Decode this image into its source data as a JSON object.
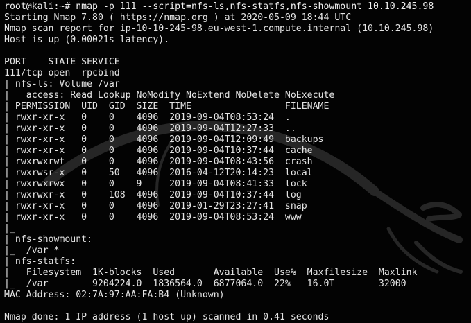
{
  "terminal": {
    "lines": [
      "root@kali:~# nmap -p 111 --script=nfs-ls,nfs-statfs,nfs-showmount 10.10.245.98",
      "Starting Nmap 7.80 ( https://nmap.org ) at 2020-05-09 18:44 UTC",
      "Nmap scan report for ip-10-10-245-98.eu-west-1.compute.internal (10.10.245.98)",
      "Host is up (0.00021s latency).",
      "",
      "PORT    STATE SERVICE",
      "111/tcp open  rpcbind",
      "| nfs-ls: Volume /var",
      "|   access: Read Lookup NoModify NoExtend NoDelete NoExecute",
      "| PERMISSION  UID  GID  SIZE  TIME                 FILENAME",
      "| rwxr-xr-x   0    0    4096  2019-09-04T08:53:24  .",
      "| rwxr-xr-x   0    0    4096  2019-09-04T12:27:33  ..",
      "| rwxr-xr-x   0    0    4096  2019-09-04T12:09:49  backups",
      "| rwxr-xr-x   0    0    4096  2019-09-04T10:37:44  cache",
      "| rwxrwxrwt   0    0    4096  2019-09-04T08:43:56  crash",
      "| rwxrwsr-x   0    50   4096  2016-04-12T20:14:23  local",
      "| rwxrwxrwx   0    0    9     2019-09-04T08:41:33  lock",
      "| rwxrwxr-x   0    108  4096  2019-09-04T10:37:44  log",
      "| rwxr-xr-x   0    0    4096  2019-01-29T23:27:41  snap",
      "| rwxr-xr-x   0    0    4096  2019-09-04T08:53:24  www",
      "|_",
      "| nfs-showmount:",
      "|_  /var *",
      "| nfs-statfs:",
      "|   Filesystem  1K-blocks  Used       Available  Use%  Maxfilesize  Maxlink",
      "|_  /var        9204224.0  1836564.0  6877064.0  22%   16.0T        32000",
      "MAC Address: 02:7A:97:AA:FA:B4 (Unknown)",
      "",
      "Nmap done: 1 IP address (1 host up) scanned in 0.41 seconds"
    ]
  },
  "colors": {
    "background": "#030303",
    "text": "#e4e4e4",
    "watermark": "#2a2a2a"
  },
  "icons": {
    "watermark": "kali-dragon-logo"
  }
}
